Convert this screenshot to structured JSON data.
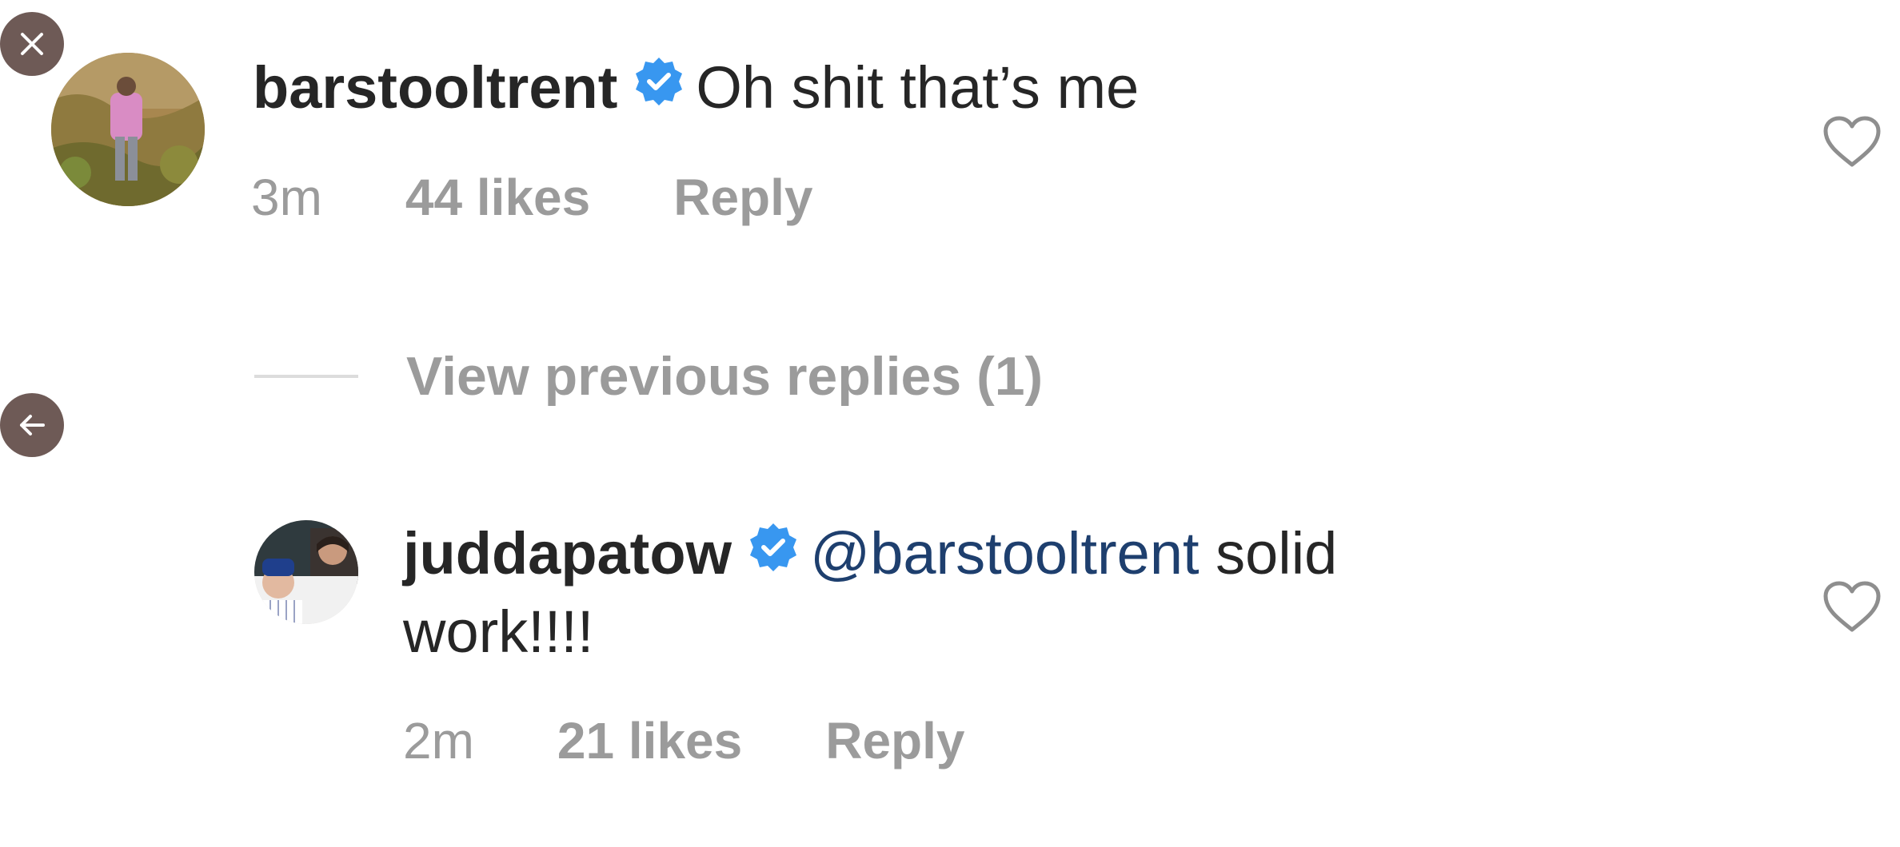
{
  "comments": [
    {
      "username": "barstooltrent",
      "verified": true,
      "text": "Oh shit that’s me",
      "time": "3m",
      "likes": "44 likes",
      "reply_label": "Reply"
    }
  ],
  "view_previous_label": "View previous replies (1)",
  "reply_comment": {
    "username": "judd​apatow",
    "verified": true,
    "mention": "@barstooltrent",
    "text_after_mention": " solid",
    "text_line2": "work!!!!",
    "time": "2m",
    "likes": "21 likes",
    "reply_label": "Reply"
  },
  "colors": {
    "verified_blue": "#3897f0",
    "mention_blue": "#1e3f6e",
    "meta_gray": "#9b9b9b",
    "overlay_button": "#6e5a56"
  }
}
